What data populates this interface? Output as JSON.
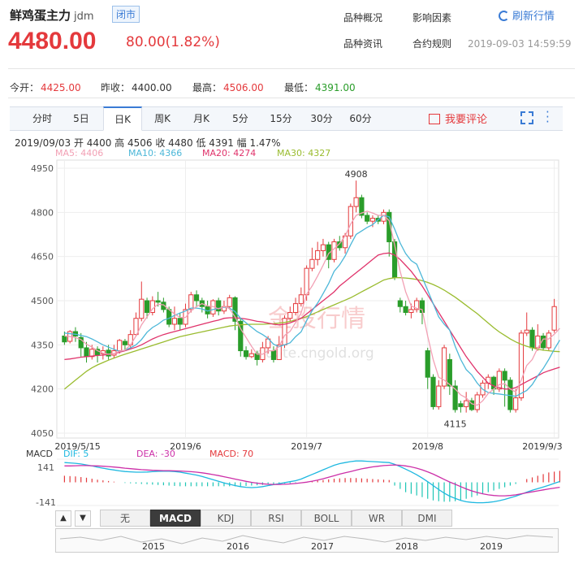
{
  "header": {
    "name": "鲜鸡蛋主力",
    "code": "jdm",
    "status": "闭市",
    "price": "4480.00",
    "change": "80.00(1.82%)",
    "links": [
      "品种概况",
      "影响因素",
      "品种资讯",
      "合约规则"
    ],
    "refresh": "刷新行情",
    "timestamp": "2019-09-03 14:59:59"
  },
  "stats": {
    "open_label": "今开：",
    "open": "4425.00",
    "prev_label": "昨收：",
    "prev": "4400.00",
    "high_label": "最高：",
    "high": "4506.00",
    "low_label": "最低：",
    "low": "4391.00"
  },
  "tabs": [
    "分时",
    "5日",
    "日K",
    "周K",
    "月K",
    "5分",
    "15分",
    "30分",
    "60分"
  ],
  "active_tab": "日K",
  "comment": "我要评论",
  "ohlc_line": "2019/09/03  开 4400  高 4506  收 4480  低 4391  幅 1.47%",
  "ma_labels": [
    {
      "text": "MA5: 4406",
      "color": "#f2a0b4"
    },
    {
      "text": "MA10: 4366",
      "color": "#4cb7d8"
    },
    {
      "text": "MA20: 4274",
      "color": "#e0336b"
    },
    {
      "text": "MA30: 4327",
      "color": "#9abc2f"
    }
  ],
  "watermark": {
    "text": "金投行情",
    "url": "quote.cngold.org"
  },
  "macd_labels": {
    "title": "MACD",
    "dif": "DIF: 5",
    "dea": "DEA: -30",
    "macd": "MACD: 70",
    "top": "141",
    "bottom": "-141"
  },
  "indicators": [
    "无",
    "MACD",
    "KDJ",
    "RSI",
    "BOLL",
    "WR",
    "DMI"
  ],
  "active_indicator": "MACD",
  "nav_arrows": [
    "▲",
    "▼"
  ],
  "navigator_years": [
    "2015",
    "2016",
    "2017",
    "2018",
    "2019"
  ],
  "colors": {
    "up": "#e4393c",
    "down": "#2a9d2a",
    "ma5": "#f2a0b4",
    "ma10": "#4cb7d8",
    "ma20": "#e0336b",
    "ma30": "#9abc2f",
    "dif": "#1eb8e0",
    "dea": "#cc2fa8"
  },
  "chart_data": {
    "type": "candlestick",
    "ylim": [
      4050,
      4950
    ],
    "yticks": [
      4950,
      4800,
      4650,
      4500,
      4350,
      4200,
      4050
    ],
    "xtick_labels": [
      "2019/5/15",
      "2019/6",
      "2019/7",
      "2019/8",
      "2019/9/3"
    ],
    "annotations": [
      {
        "text": "4908",
        "value": 4908
      },
      {
        "text": "4115",
        "value": 4115
      }
    ],
    "candles": [
      [
        4380,
        4360,
        4395,
        4350
      ],
      [
        4362,
        4395,
        4400,
        4355
      ],
      [
        4395,
        4380,
        4410,
        4360
      ],
      [
        4375,
        4340,
        4390,
        4310
      ],
      [
        4340,
        4310,
        4360,
        4290
      ],
      [
        4310,
        4335,
        4350,
        4300
      ],
      [
        4335,
        4315,
        4345,
        4290
      ],
      [
        4320,
        4330,
        4345,
        4300
      ],
      [
        4332,
        4312,
        4350,
        4300
      ],
      [
        4315,
        4330,
        4350,
        4305
      ],
      [
        4330,
        4365,
        4370,
        4320
      ],
      [
        4362,
        4350,
        4370,
        4330
      ],
      [
        4350,
        4385,
        4400,
        4340
      ],
      [
        4385,
        4440,
        4460,
        4380
      ],
      [
        4440,
        4505,
        4565,
        4430
      ],
      [
        4500,
        4460,
        4510,
        4440
      ],
      [
        4460,
        4500,
        4515,
        4450
      ],
      [
        4500,
        4495,
        4530,
        4480
      ],
      [
        4495,
        4470,
        4510,
        4460
      ],
      [
        4470,
        4420,
        4480,
        4410
      ],
      [
        4420,
        4440,
        4480,
        4400
      ],
      [
        4440,
        4420,
        4460,
        4400
      ],
      [
        4420,
        4470,
        4490,
        4410
      ],
      [
        4470,
        4520,
        4530,
        4460
      ],
      [
        4520,
        4500,
        4535,
        4480
      ],
      [
        4500,
        4480,
        4510,
        4460
      ],
      [
        4480,
        4455,
        4500,
        4440
      ],
      [
        4455,
        4500,
        4505,
        4445
      ],
      [
        4500,
        4465,
        4510,
        4450
      ],
      [
        4465,
        4480,
        4500,
        4455
      ],
      [
        4480,
        4510,
        4520,
        4470
      ],
      [
        4510,
        4430,
        4515,
        4400
      ],
      [
        4430,
        4330,
        4440,
        4310
      ],
      [
        4330,
        4310,
        4345,
        4300
      ],
      [
        4310,
        4320,
        4335,
        4305
      ],
      [
        4320,
        4300,
        4330,
        4280
      ],
      [
        4300,
        4340,
        4360,
        4290
      ],
      [
        4340,
        4370,
        4380,
        4320
      ],
      [
        4330,
        4300,
        4345,
        4290
      ],
      [
        4300,
        4350,
        4380,
        4300
      ],
      [
        4350,
        4440,
        4450,
        4340
      ],
      [
        4440,
        4460,
        4480,
        4430
      ],
      [
        4460,
        4490,
        4510,
        4450
      ],
      [
        4490,
        4520,
        4545,
        4480
      ],
      [
        4520,
        4610,
        4620,
        4500
      ],
      [
        4610,
        4640,
        4680,
        4600
      ],
      [
        4640,
        4670,
        4700,
        4620
      ],
      [
        4670,
        4690,
        4710,
        4650
      ],
      [
        4690,
        4640,
        4700,
        4610
      ],
      [
        4640,
        4700,
        4710,
        4630
      ],
      [
        4700,
        4680,
        4720,
        4670
      ],
      [
        4680,
        4720,
        4730,
        4660
      ],
      [
        4720,
        4820,
        4830,
        4710
      ],
      [
        4820,
        4850,
        4908,
        4800
      ],
      [
        4850,
        4790,
        4860,
        4780
      ],
      [
        4790,
        4770,
        4800,
        4760
      ],
      [
        4770,
        4780,
        4790,
        4750
      ],
      [
        4780,
        4770,
        4790,
        4760
      ],
      [
        4770,
        4800,
        4810,
        4760
      ],
      [
        4800,
        4700,
        4810,
        4650
      ],
      [
        4700,
        4580,
        4710,
        4570
      ],
      [
        4500,
        4480,
        4510,
        4460
      ],
      [
        4480,
        4460,
        4500,
        4450
      ],
      [
        4460,
        4470,
        4490,
        4440
      ],
      [
        4470,
        4500,
        4510,
        4460
      ],
      [
        4500,
        4460,
        4510,
        4420
      ],
      [
        4330,
        4240,
        4340,
        4200
      ],
      [
        4240,
        4140,
        4250,
        4130
      ],
      [
        4140,
        4210,
        4230,
        4130
      ],
      [
        4210,
        4340,
        4350,
        4200
      ],
      [
        4300,
        4210,
        4320,
        4180
      ],
      [
        4210,
        4130,
        4230,
        4120
      ],
      [
        4150,
        4140,
        4160,
        4120
      ],
      [
        4140,
        4160,
        4190,
        4120
      ],
      [
        4160,
        4130,
        4170,
        4125
      ],
      [
        4130,
        4180,
        4190,
        4120
      ],
      [
        4180,
        4220,
        4230,
        4170
      ],
      [
        4220,
        4240,
        4250,
        4200
      ],
      [
        4240,
        4200,
        4245,
        4180
      ],
      [
        4200,
        4260,
        4270,
        4190
      ],
      [
        4260,
        4230,
        4270,
        4140
      ],
      [
        4230,
        4130,
        4240,
        4120
      ],
      [
        4130,
        4170,
        4200,
        4120
      ],
      [
        4170,
        4390,
        4400,
        4160
      ],
      [
        4390,
        4400,
        4460,
        4380
      ],
      [
        4400,
        4340,
        4410,
        4330
      ],
      [
        4340,
        4380,
        4420,
        4330
      ],
      [
        4380,
        4340,
        4390,
        4330
      ],
      [
        4340,
        4390,
        4400,
        4330
      ],
      [
        4400,
        4480,
        4506,
        4391
      ]
    ],
    "ma5": [
      4380,
      4378,
      4375,
      4368,
      4352,
      4342,
      4330,
      4322,
      4318,
      4320,
      4328,
      4332,
      4350,
      4380,
      4418,
      4445,
      4472,
      4488,
      4486,
      4470,
      4455,
      4443,
      4443,
      4466,
      4480,
      4490,
      4482,
      4480,
      4472,
      4480,
      4473,
      4445,
      4405,
      4375,
      4345,
      4318,
      4318,
      4330,
      4330,
      4344,
      4382,
      4396,
      4426,
      4458,
      4522,
      4550,
      4584,
      4620,
      4660,
      4676,
      4694,
      4720,
      4760,
      4790,
      4798,
      4804,
      4798,
      4790,
      4790,
      4772,
      4688,
      4600,
      4530,
      4482,
      4474,
      4470,
      4380,
      4300,
      4240,
      4230,
      4215,
      4200,
      4180,
      4170,
      4150,
      4145,
      4160,
      4185,
      4200,
      4215,
      4218,
      4200,
      4190,
      4230,
      4280,
      4300,
      4340,
      4370,
      4370,
      4386,
      4406
    ],
    "ma10": [
      4390,
      4388,
      4386,
      4382,
      4378,
      4370,
      4360,
      4350,
      4342,
      4335,
      4328,
      4332,
      4340,
      4350,
      4368,
      4393,
      4409,
      4420,
      4434,
      4440,
      4450,
      4458,
      4465,
      4475,
      4475,
      4472,
      4465,
      4470,
      4474,
      4478,
      4475,
      4463,
      4440,
      4425,
      4410,
      4395,
      4385,
      4372,
      4352,
      4344,
      4350,
      4357,
      4378,
      4394,
      4432,
      4466,
      4492,
      4524,
      4558,
      4600,
      4622,
      4652,
      4690,
      4725,
      4737,
      4749,
      4758,
      4775,
      4790,
      4785,
      4743,
      4696,
      4660,
      4636,
      4624,
      4580,
      4535,
      4490,
      4445,
      4420,
      4400,
      4345,
      4300,
      4266,
      4248,
      4220,
      4199,
      4188,
      4185,
      4183,
      4180,
      4178,
      4175,
      4185,
      4195,
      4215,
      4245,
      4270,
      4300,
      4335,
      4366
    ],
    "ma20": [
      4300,
      4302,
      4305,
      4308,
      4310,
      4312,
      4314,
      4315,
      4318,
      4320,
      4325,
      4330,
      4336,
      4342,
      4350,
      4360,
      4370,
      4378,
      4385,
      4390,
      4395,
      4400,
      4405,
      4410,
      4415,
      4420,
      4425,
      4430,
      4434,
      4440,
      4442,
      4442,
      4440,
      4438,
      4434,
      4430,
      4428,
      4424,
      4420,
      4418,
      4420,
      4425,
      4432,
      4440,
      4455,
      4470,
      4485,
      4500,
      4515,
      4530,
      4550,
      4565,
      4580,
      4595,
      4610,
      4625,
      4640,
      4655,
      4660,
      4662,
      4655,
      4640,
      4620,
      4600,
      4575,
      4550,
      4520,
      4490,
      4460,
      4430,
      4400,
      4370,
      4340,
      4310,
      4285,
      4260,
      4240,
      4220,
      4210,
      4205,
      4200,
      4200,
      4205,
      4215,
      4225,
      4235,
      4245,
      4255,
      4262,
      4268,
      4274
    ],
    "ma30": [
      4200,
      4215,
      4230,
      4245,
      4260,
      4272,
      4282,
      4290,
      4298,
      4305,
      4312,
      4318,
      4324,
      4330,
      4336,
      4342,
      4348,
      4354,
      4360,
      4366,
      4372,
      4378,
      4382,
      4386,
      4390,
      4394,
      4398,
      4402,
      4406,
      4410,
      4414,
      4416,
      4418,
      4419,
      4420,
      4420,
      4420,
      4421,
      4422,
      4424,
      4426,
      4430,
      4434,
      4440,
      4446,
      4454,
      4462,
      4470,
      4478,
      4486,
      4494,
      4502,
      4510,
      4520,
      4530,
      4540,
      4550,
      4560,
      4570,
      4575,
      4578,
      4578,
      4577,
      4575,
      4572,
      4568,
      4562,
      4555,
      4546,
      4536,
      4524,
      4512,
      4498,
      4484,
      4470,
      4456,
      4440,
      4424,
      4408,
      4394,
      4382,
      4370,
      4360,
      4352,
      4345,
      4340,
      4335,
      4332,
      4330,
      4328,
      4327
    ],
    "dif": [
      120,
      118,
      116,
      112,
      106,
      100,
      92,
      86,
      80,
      75,
      70,
      66,
      64,
      62,
      62,
      63,
      65,
      67,
      68,
      68,
      66,
      62,
      56,
      50,
      44,
      36,
      26,
      16,
      6,
      -4,
      -12,
      -20,
      -26,
      -30,
      -32,
      -30,
      -26,
      -20,
      -14,
      -8,
      -2,
      4,
      10,
      20,
      34,
      48,
      62,
      76,
      90,
      104,
      114,
      120,
      126,
      130,
      130,
      128,
      126,
      124,
      122,
      120,
      110,
      96,
      80,
      64,
      46,
      26,
      4,
      -20,
      -44,
      -66,
      -84,
      -98,
      -110,
      -118,
      -122,
      -124,
      -124,
      -122,
      -118,
      -112,
      -104,
      -94,
      -84,
      -72,
      -60,
      -48,
      -38,
      -28,
      -18,
      -6,
      5
    ],
    "dea": [
      100,
      100,
      101,
      102,
      102,
      101,
      100,
      98,
      96,
      93,
      90,
      86,
      83,
      80,
      77,
      75,
      73,
      72,
      71,
      71,
      70,
      69,
      67,
      65,
      62,
      58,
      53,
      47,
      41,
      34,
      27,
      20,
      13,
      6,
      0,
      -5,
      -9,
      -12,
      -13,
      -13,
      -12,
      -10,
      -7,
      -3,
      1,
      7,
      14,
      22,
      31,
      40,
      50,
      58,
      66,
      74,
      82,
      88,
      94,
      98,
      102,
      104,
      106,
      104,
      100,
      94,
      86,
      76,
      64,
      50,
      34,
      18,
      2,
      -12,
      -26,
      -40,
      -52,
      -62,
      -70,
      -76,
      -80,
      -82,
      -82,
      -80,
      -76,
      -70,
      -64,
      -58,
      -52,
      -46,
      -40,
      -35,
      -30
    ],
    "macd_hist": [
      40,
      38,
      36,
      32,
      28,
      22,
      16,
      12,
      8,
      4,
      0,
      -4,
      -6,
      -8,
      -10,
      -12,
      -14,
      -16,
      -18,
      -20,
      -22,
      -24,
      -24,
      -24,
      -24,
      -24,
      -24,
      -24,
      -24,
      -24,
      -24,
      -24,
      -24,
      -22,
      -20,
      -18,
      -16,
      -14,
      -12,
      -10,
      -8,
      -6,
      -4,
      -2,
      2,
      6,
      10,
      14,
      18,
      22,
      24,
      26,
      26,
      26,
      24,
      22,
      20,
      18,
      16,
      14,
      -20,
      -40,
      -60,
      -70,
      -80,
      -90,
      -100,
      -110,
      -115,
      -118,
      -118,
      -115,
      -110,
      -100,
      -90,
      -80,
      -70,
      -60,
      -50,
      -40,
      -30,
      -20,
      -10,
      0,
      20,
      30,
      40,
      50,
      60,
      65,
      70
    ]
  }
}
